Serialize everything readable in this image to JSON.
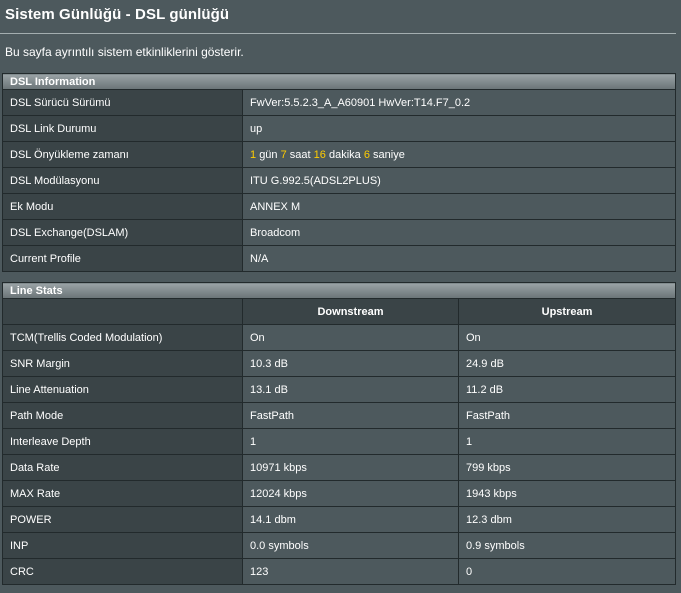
{
  "page": {
    "title": "Sistem Günlüğü - DSL günlüğü",
    "description": "Bu sayfa ayrıntılı sistem etkinliklerini gösterir."
  },
  "dsl_info": {
    "header": "DSL Information",
    "rows": [
      {
        "label": "DSL Sürücü Sürümü",
        "value": "FwVer:5.5.2.3_A_A60901 HwVer:T14.F7_0.2"
      },
      {
        "label": "DSL Link Durumu",
        "value": "up"
      },
      {
        "label": "DSL Önyükleme zamanı",
        "uptime": {
          "days": "1",
          "days_unit": "gün",
          "hours": "7",
          "hours_unit": "saat",
          "minutes": "16",
          "minutes_unit": "dakika",
          "seconds": "6",
          "seconds_unit": "saniye"
        }
      },
      {
        "label": "DSL Modülasyonu",
        "value": "ITU G.992.5(ADSL2PLUS)"
      },
      {
        "label": "Ek Modu",
        "value": "ANNEX M"
      },
      {
        "label": "DSL Exchange(DSLAM)",
        "value": "Broadcom"
      },
      {
        "label": "Current Profile",
        "value": "N/A"
      }
    ]
  },
  "line_stats": {
    "header": "Line Stats",
    "columns": [
      "Downstream",
      "Upstream"
    ],
    "rows": [
      {
        "label": "TCM(Trellis Coded Modulation)",
        "down": "On",
        "up": "On"
      },
      {
        "label": "SNR Margin",
        "down": "10.3 dB",
        "up": "24.9 dB"
      },
      {
        "label": "Line Attenuation",
        "down": "13.1 dB",
        "up": "11.2 dB"
      },
      {
        "label": "Path Mode",
        "down": "FastPath",
        "up": "FastPath"
      },
      {
        "label": "Interleave Depth",
        "down": "1",
        "up": "1"
      },
      {
        "label": "Data Rate",
        "down": "10971 kbps",
        "up": "799 kbps"
      },
      {
        "label": "MAX Rate",
        "down": "12024 kbps",
        "up": "1943 kbps"
      },
      {
        "label": "POWER",
        "down": "14.1 dbm",
        "up": "12.3 dbm"
      },
      {
        "label": "INP",
        "down": "0.0 symbols",
        "up": "0.9 symbols"
      },
      {
        "label": "CRC",
        "down": "123",
        "up": "0"
      }
    ]
  },
  "colors": {
    "background": "#4d595d",
    "label_cell": "#3a4447",
    "highlight": "#ffcc00"
  }
}
